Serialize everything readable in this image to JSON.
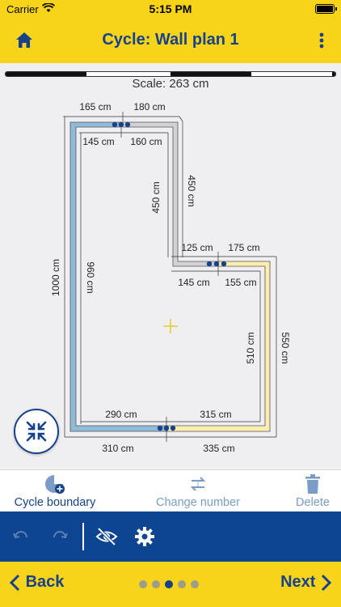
{
  "status_bar": {
    "carrier": "Carrier",
    "time": "5:15 PM"
  },
  "nav": {
    "title": "Cycle: Wall plan 1",
    "home_icon": "home-icon",
    "more_icon": "more-vertical-icon"
  },
  "canvas": {
    "scale_label": "Scale: 263 cm",
    "dimensions": {
      "outer_top_left": "165 cm",
      "outer_top_right": "180 cm",
      "inner_top_left": "145 cm",
      "inner_top_right": "160 cm",
      "inner_notch_vertical": "450 cm",
      "outer_notch_vertical": "450 cm",
      "outer_mid_left": "125 cm",
      "outer_mid_right": "175 cm",
      "inner_mid_left": "145 cm",
      "inner_mid_right": "155 cm",
      "outer_left": "1000 cm",
      "inner_left": "960 cm",
      "inner_right": "510 cm",
      "outer_right": "550 cm",
      "inner_bottom_left": "290 cm",
      "inner_bottom_right": "315 cm",
      "outer_bottom_left": "310 cm",
      "outer_bottom_right": "335 cm"
    },
    "wall_colors": {
      "blue": "#8fbbd9",
      "gray": "#d2d2d4",
      "yellow": "#fbeeb0"
    }
  },
  "fab": {
    "icon": "collapse-arrows-icon"
  },
  "toolbar": {
    "cycle_boundary": "Cycle boundary",
    "change_number": "Change number",
    "delete": "Delete"
  },
  "actions": {
    "undo_icon": "undo-icon",
    "redo_icon": "redo-icon",
    "hide_icon": "eye-slash-icon",
    "settings_icon": "gear-icon"
  },
  "footer": {
    "back": "Back",
    "next": "Next",
    "step_count": 5,
    "active_step": 3
  },
  "colors": {
    "brand_yellow": "#f7d31a",
    "brand_blue": "#17428a",
    "action_blue": "#0e4592"
  }
}
